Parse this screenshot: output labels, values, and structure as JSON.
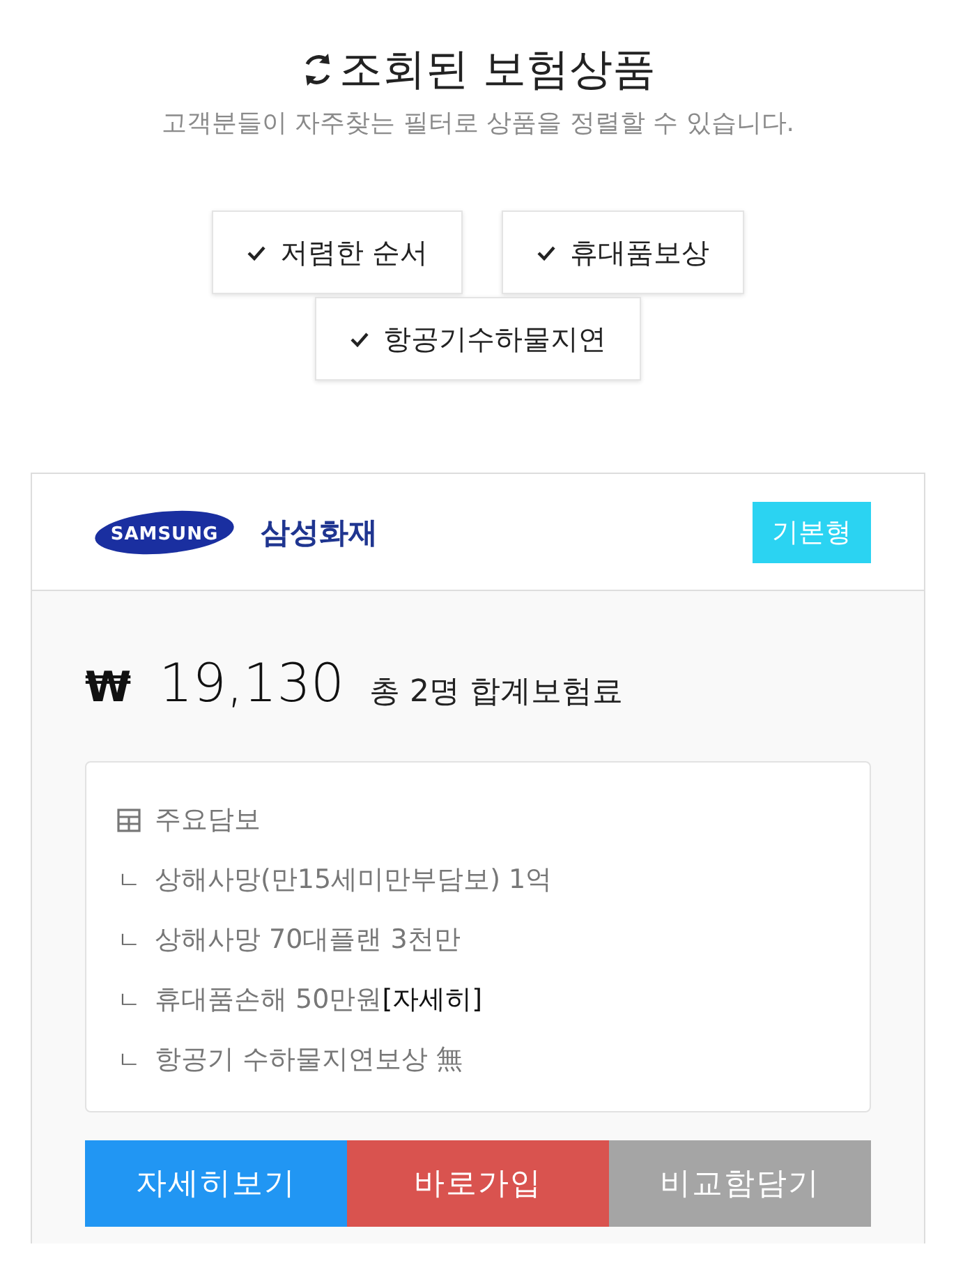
{
  "header": {
    "title": "조회된 보험상품",
    "subtitle": "고객분들이 자주찾는 필터로 상품을 정렬할 수 있습니다."
  },
  "filters": [
    {
      "label": "저렴한 순서",
      "checked": true
    },
    {
      "label": "휴대품보상",
      "checked": true
    },
    {
      "label": "항공기수하물지연",
      "checked": true
    }
  ],
  "products": [
    {
      "insurer": {
        "logo_text": "SAMSUNG",
        "name": "삼성화재"
      },
      "plan_badge": "기본형",
      "currency": "₩",
      "price": "19,130",
      "price_note": "총 2명 합계보험료",
      "coverage": {
        "title": "주요담보",
        "items": [
          {
            "marker": "ㄴ",
            "text": "상해사망(만15세미만부담보) 1억"
          },
          {
            "marker": "ㄴ",
            "text": "상해사망 70대플랜 3천만"
          },
          {
            "marker": "ㄴ",
            "text": "휴대품손해 50만원",
            "link": "[자세히]"
          },
          {
            "marker": "ㄴ",
            "text": "항공기 수하물지연보상 無"
          }
        ]
      },
      "actions": [
        {
          "label": "자세히보기",
          "kind": "detail"
        },
        {
          "label": "바로가입",
          "kind": "join"
        },
        {
          "label": "비교함담기",
          "kind": "compare"
        }
      ]
    }
  ]
}
